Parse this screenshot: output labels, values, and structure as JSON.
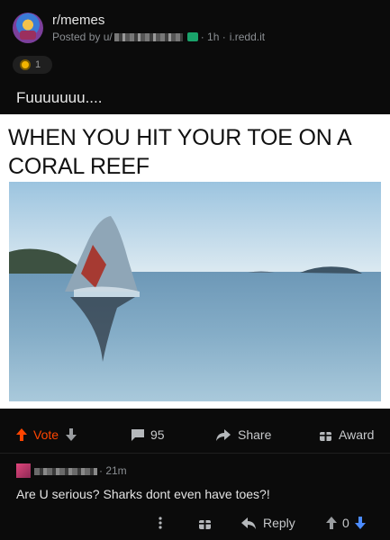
{
  "post": {
    "subreddit": "r/memes",
    "posted_by_prefix": "Posted by u/",
    "time_ago": "· 1h ·",
    "domain": "i.redd.it",
    "award_count": "1",
    "title": "Fuuuuuuu....",
    "meme_caption": "WHEN YOU HIT YOUR TOE ON A CORAL REEF"
  },
  "actions": {
    "vote_label": "Vote",
    "comments_count": "95",
    "share_label": "Share",
    "award_label": "Award"
  },
  "comment": {
    "time_ago": "· 21m",
    "body": "Are U serious? Sharks dont even have toes?!",
    "reply_label": "Reply",
    "score": "0"
  },
  "colors": {
    "background": "#0b0b0b",
    "upvote_accent": "#ff4500",
    "downvote_accent": "#4c8cff"
  },
  "icons": [
    "subreddit-avatar",
    "home-icon",
    "award-coin-icon",
    "upvote-arrow-icon",
    "downvote-arrow-icon",
    "comment-icon",
    "share-arrow-icon",
    "award-icon",
    "more-options-icon",
    "gift-icon",
    "reply-arrow-icon"
  ]
}
